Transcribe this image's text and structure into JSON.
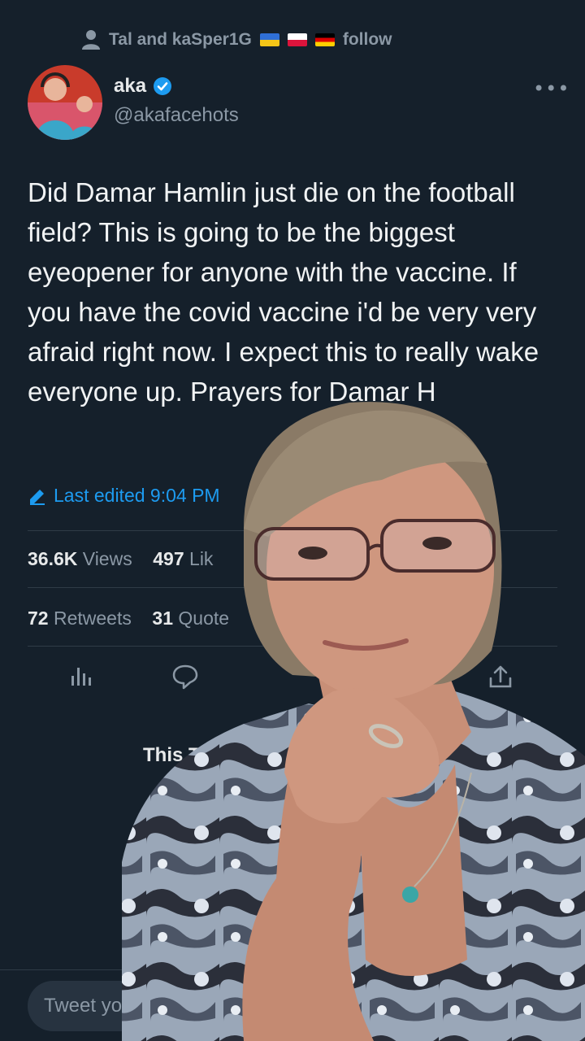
{
  "header": {
    "followed_by": "Tal and kaSper1G",
    "follow_label": "follow",
    "flags": [
      "flag-ukraine",
      "flag-poland",
      "flag-germany"
    ]
  },
  "author": {
    "name": "aka",
    "handle": "@akafacehots",
    "verified_icon": "verified-badge-icon"
  },
  "tweet": {
    "text": "Did Damar Hamlin just die on the football field? This is going to be the biggest eyeopener for anyone with the vaccine. If you have the covid vaccine i'd be very very afraid right now. I expect this to really wake everyone up. Prayers for Damar H",
    "edited_label": "Last edited 9:04 PM"
  },
  "stats": {
    "views_count": "36.6K",
    "views_label": "Views",
    "likes_count": "497",
    "likes_label": "Lik",
    "retweets_count": "72",
    "retweets_label": "Retweets",
    "quotes_count": "31",
    "quotes_label": "Quote"
  },
  "thread": {
    "title": "This Twe"
  },
  "reply": {
    "placeholder": "Tweet yo"
  },
  "colors": {
    "background": "#15202b",
    "accent": "#1d9bf0",
    "muted": "#8b98a5"
  }
}
